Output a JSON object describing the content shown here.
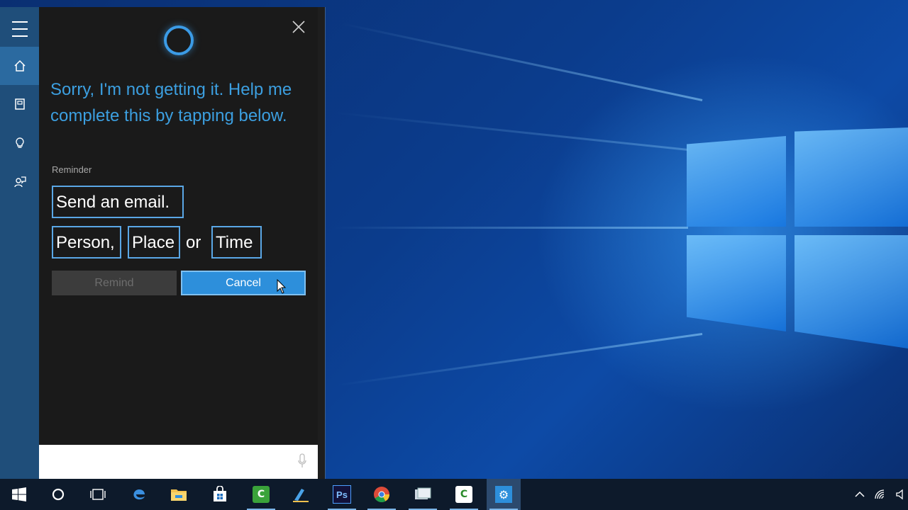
{
  "cortana": {
    "message": "Sorry, I'm not getting it. Help me complete this by tapping below.",
    "reminder_label": "Reminder",
    "subject_slot": "Send an email.",
    "slot_person": "Person,",
    "slot_place": "Place",
    "slot_or": "or",
    "slot_time": "Time",
    "remind_button": "Remind",
    "cancel_button": "Cancel"
  },
  "rail": {
    "icons": [
      "hamburger-menu-icon",
      "home-icon",
      "notebook-icon",
      "lightbulb-icon",
      "feedback-icon"
    ],
    "active": "home-icon"
  },
  "search": {
    "placeholder": ""
  },
  "taskbar": {
    "apps": [
      "start-icon",
      "cortana-icon",
      "task-view-icon",
      "edge-icon",
      "file-explorer-icon",
      "store-icon",
      "camtasia-icon",
      "pen-tool-icon",
      "photoshop-icon",
      "chrome-icon",
      "app-icon",
      "camtasia-recorder-icon",
      "settings-icon"
    ],
    "photoshop_label": "Ps"
  },
  "colors": {
    "accent": "#3c9fe0",
    "rail": "#1f4e7a",
    "cancel": "#2d8fdb"
  }
}
